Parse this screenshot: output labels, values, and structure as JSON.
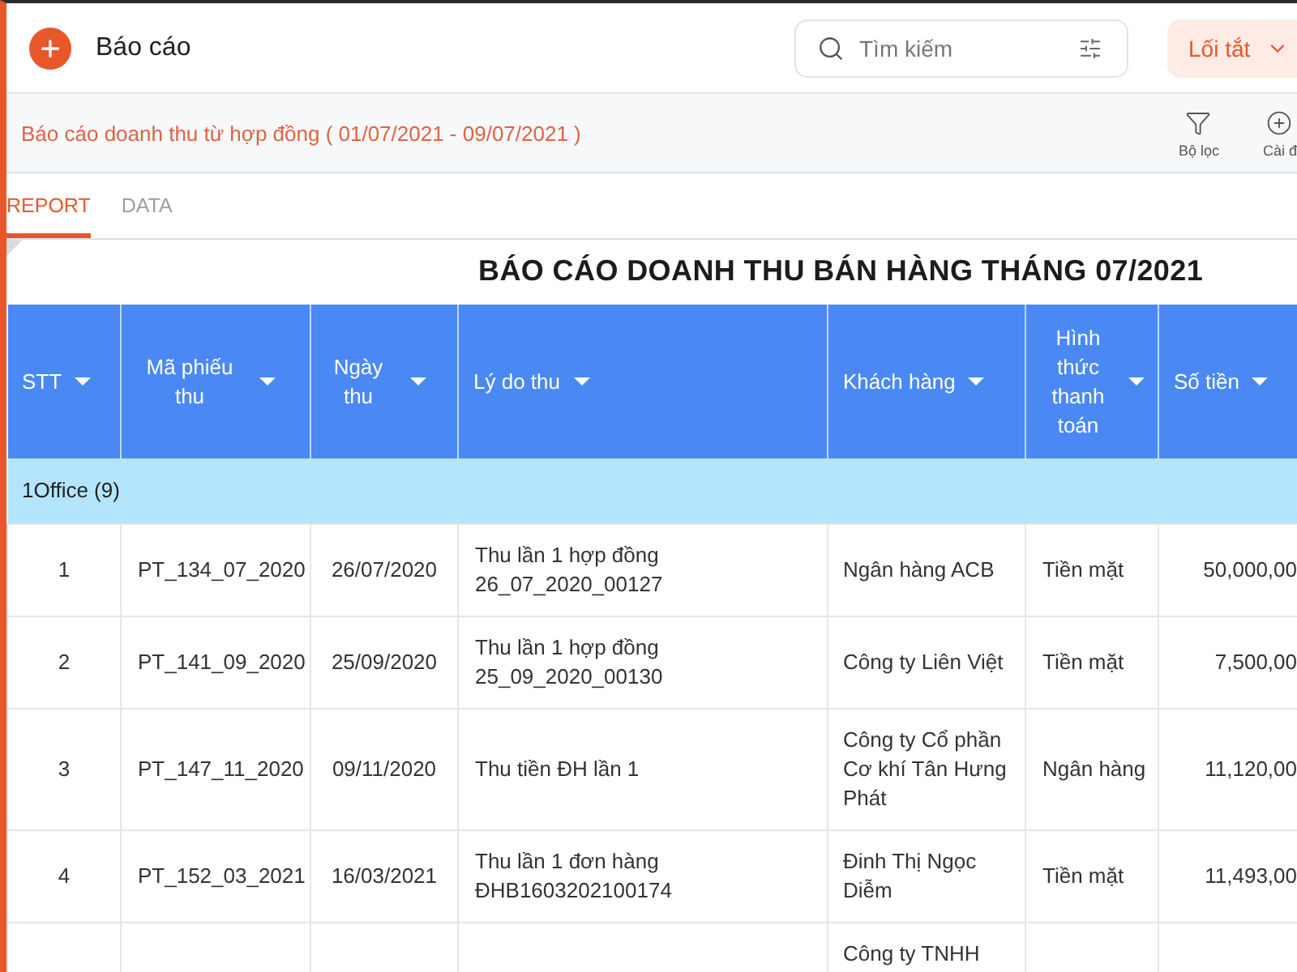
{
  "header": {
    "title": "Báo cáo",
    "search": {
      "placeholder": "Tìm kiếm"
    },
    "shortcut_button": "Lối tắt"
  },
  "subheader": {
    "report_title": "Báo cáo doanh thu từ hợp đồng ( 01/07/2021 - 09/07/2021 )",
    "actions": [
      {
        "kind": "filter",
        "label": "Bộ lọc"
      },
      {
        "kind": "add",
        "label": "Cài đ"
      }
    ]
  },
  "tabs": [
    {
      "label": "REPORT",
      "selected": true
    },
    {
      "label": "DATA",
      "selected": false
    }
  ],
  "report": {
    "title": "BÁO CÁO DOANH THU BÁN HÀNG THÁNG 07/2021",
    "columns": [
      "STT",
      "Mã phiếu thu",
      "Ngày thu",
      "Lý do thu",
      "Khách hàng",
      "Hình thức thanh toán",
      "Số tiền"
    ],
    "groups": [
      {
        "label": "1Office (9)",
        "rows": [
          {
            "no": "1",
            "receipt_code": "PT_134_07_2020",
            "date": "26/07/2020",
            "reason": "Thu lần 1 hợp đồng 26_07_2020_00127",
            "customer": "Ngân hàng ACB",
            "payment_method": "Tiền mặt",
            "amount": "50,000,00"
          },
          {
            "no": "2",
            "receipt_code": "PT_141_09_2020",
            "date": "25/09/2020",
            "reason": "Thu lần 1 hợp đồng 25_09_2020_00130",
            "customer": "Công ty Liên Việt",
            "payment_method": "Tiền mặt",
            "amount": "7,500,00"
          },
          {
            "no": "3",
            "receipt_code": "PT_147_11_2020",
            "date": "09/11/2020",
            "reason": "Thu tiền ĐH lần 1",
            "customer": "Công ty Cổ phần Cơ khí Tân Hưng Phát",
            "payment_method": "Ngân hàng",
            "amount": "11,120,00"
          },
          {
            "no": "4",
            "receipt_code": "PT_152_03_2021",
            "date": "16/03/2021",
            "reason": "Thu lần 1 đơn hàng ĐHB1603202100174",
            "customer": "Đinh Thị Ngọc Diễm",
            "payment_method": "Tiền mặt",
            "amount": "11,493,00"
          },
          {
            "customer": "Công ty TNHH"
          }
        ]
      }
    ]
  }
}
